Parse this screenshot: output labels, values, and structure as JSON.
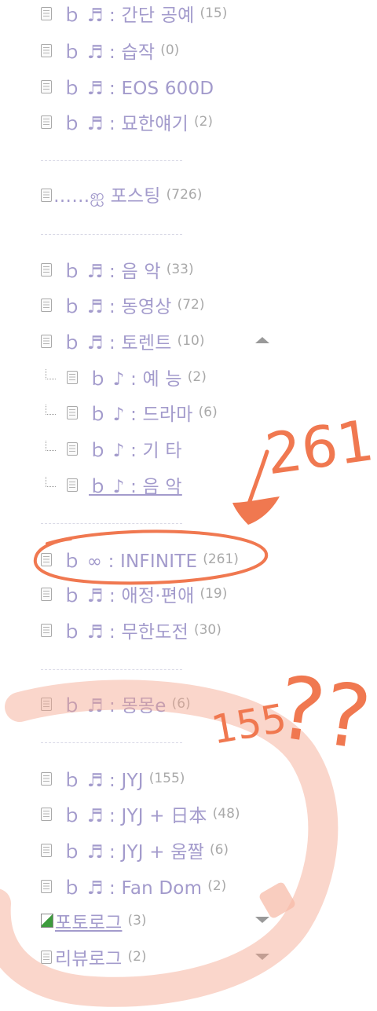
{
  "items": [
    {
      "label": "ｂ ♬ : 간단 공예",
      "count": "(15)"
    },
    {
      "label": "ｂ ♬ : 습작",
      "count": "(0)"
    },
    {
      "label": "ｂ ♬ : EOS 600D",
      "count": ""
    },
    {
      "label": "ｂ ♬ : 묘한얘기",
      "count": "(2)"
    },
    {
      "label": "……ஐ 포스팅",
      "count": "(726)"
    },
    {
      "label": "ｂ ♬ : 음 악",
      "count": "(33)"
    },
    {
      "label": "ｂ ♬ : 동영상",
      "count": "(72)"
    },
    {
      "label": "ｂ ♬ : 토렌트",
      "count": "(10)"
    },
    {
      "label": "ｂ ♪ : 예 능",
      "count": "(2)"
    },
    {
      "label": "ｂ ♪ : 드라마",
      "count": "(6)"
    },
    {
      "label": "ｂ ♪ : 기 타",
      "count": ""
    },
    {
      "label": "ｂ ♪ : 음 악",
      "count": ""
    },
    {
      "label": "ｂ ∞ : INFINITE",
      "count": "(261)"
    },
    {
      "label": "ｂ ♬ : 애정·편애",
      "count": "(19)"
    },
    {
      "label": "ｂ ♬ : 무한도전",
      "count": "(30)"
    },
    {
      "label": "ｂ ♬ : 몽몽e",
      "count": "(6)"
    },
    {
      "label": "ｂ ♬ : JYJ",
      "count": "(155)"
    },
    {
      "label": "ｂ ♬ : JYJ + 日本",
      "count": "(48)"
    },
    {
      "label": "ｂ ♬ : JYJ + 움짤",
      "count": "(6)"
    },
    {
      "label": "ｂ ♬ : Fan Dom",
      "count": "(2)"
    },
    {
      "label": "포토로그",
      "count": "(3)"
    },
    {
      "label": "리뷰로그",
      "count": "(2)"
    }
  ],
  "annotations": {
    "text_261": "261",
    "text_155": "155",
    "text_q": "??",
    "color": "#f07850"
  }
}
